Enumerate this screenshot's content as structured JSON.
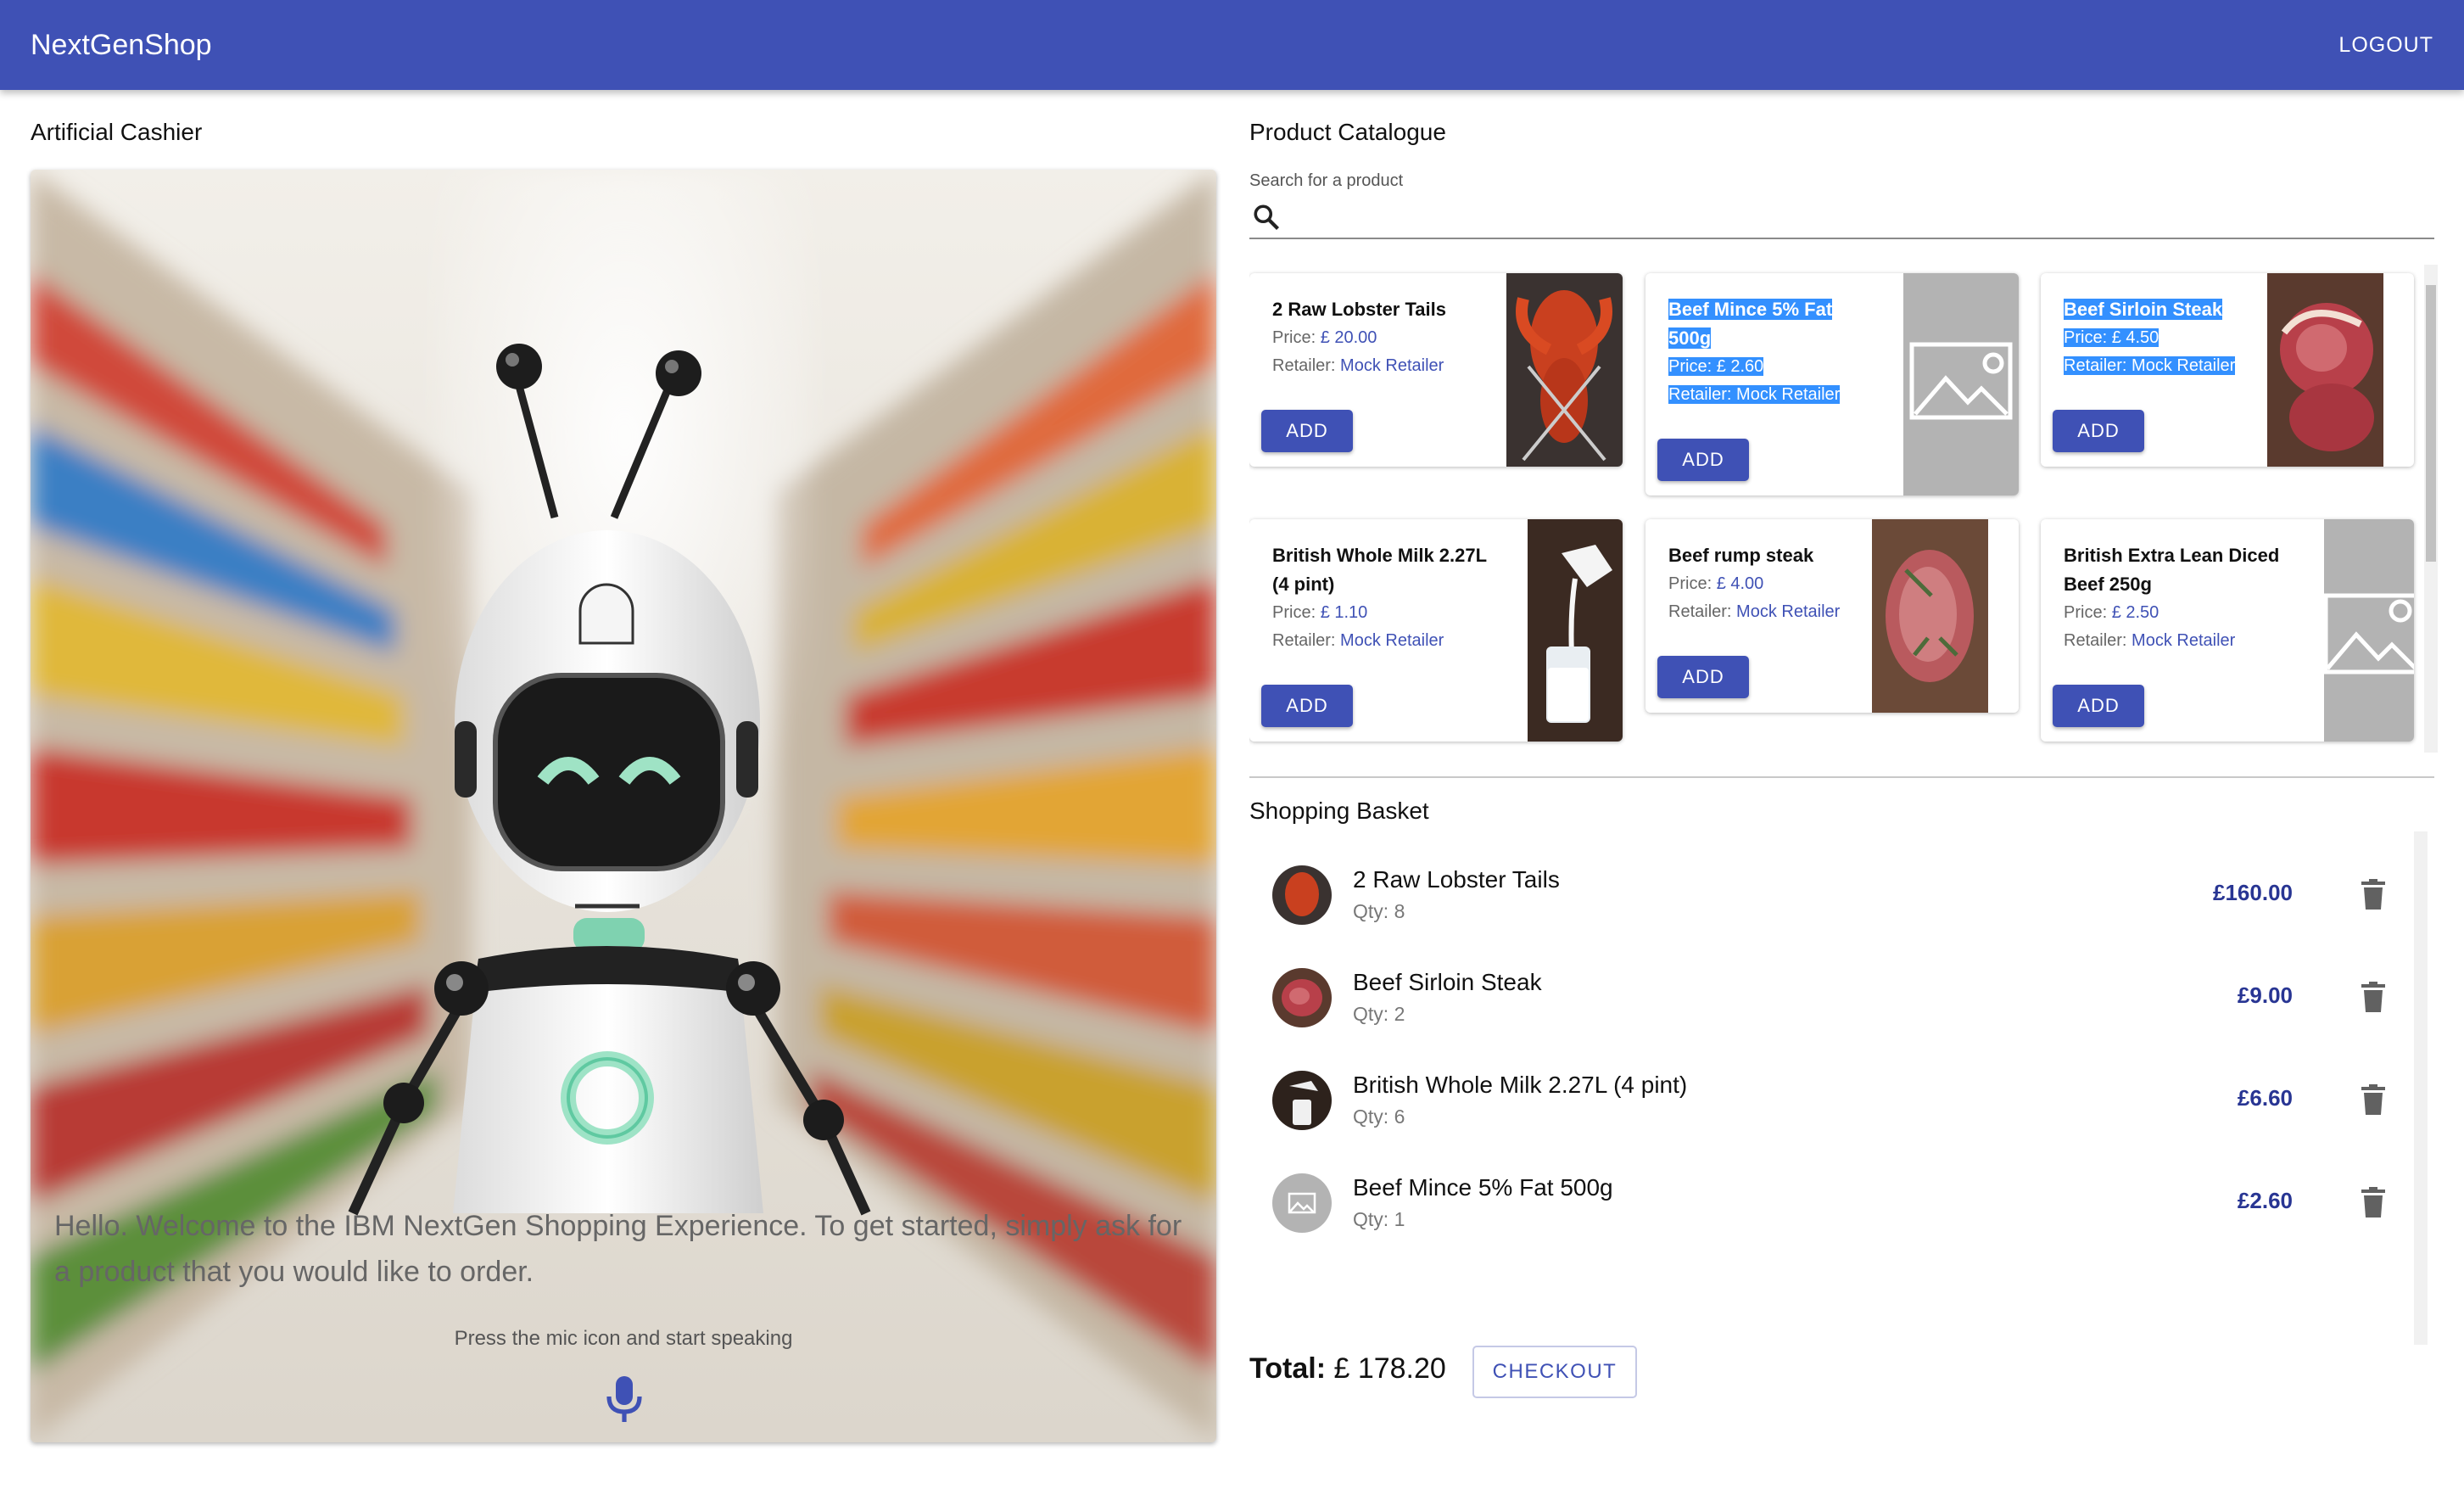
{
  "app": {
    "brand": "NextGenShop",
    "logout_label": "LOGOUT",
    "accent": "#3f51b5"
  },
  "cashier": {
    "title": "Artificial Cashier",
    "welcome": "Hello. Welcome to the IBM NextGen Shopping Experience. To get started, simply ask for a product that you would like to order.",
    "hint": "Press the mic icon and start speaking",
    "mic_icon": "mic-icon"
  },
  "catalogue": {
    "title": "Product Catalogue",
    "search_label": "Search for a product",
    "search_value": "",
    "price_prefix": "Price:",
    "retailer_prefix": "Retailer:",
    "add_label": "ADD",
    "products": [
      {
        "name_lines": [
          "2 Raw Lobster Tails"
        ],
        "price": "£ 20.00",
        "retailer": "Mock Retailer",
        "image": "lobster-image",
        "selected": false
      },
      {
        "name_lines": [
          "Beef Mince 5% Fat",
          "500g"
        ],
        "price": "£ 2.60",
        "retailer": "Mock Retailer",
        "image": "placeholder-image",
        "selected": true
      },
      {
        "name_lines": [
          "Beef Sirloin Steak"
        ],
        "price": "£ 4.50",
        "retailer": "Mock Retailer",
        "image": "sirloin-image",
        "selected": true
      },
      {
        "name_lines": [
          "British Whole Milk 2.27L",
          "(4 pint)"
        ],
        "price": "£ 1.10",
        "retailer": "Mock Retailer",
        "image": "milk-image",
        "selected": false
      },
      {
        "name_lines": [
          "Beef rump steak"
        ],
        "price": "£ 4.00",
        "retailer": "Mock Retailer",
        "image": "rump-image",
        "selected": false
      },
      {
        "name_lines": [
          "British Extra Lean Diced",
          "Beef 250g"
        ],
        "price": "£ 2.50",
        "retailer": "Mock Retailer",
        "image": "placeholder-image",
        "selected": false
      }
    ]
  },
  "basket": {
    "title": "Shopping Basket",
    "qty_prefix": "Qty:",
    "items": [
      {
        "name": "2 Raw Lobster Tails",
        "qty": "8",
        "total": "£160.00",
        "image": "lobster-image"
      },
      {
        "name": "Beef Sirloin Steak",
        "qty": "2",
        "total": "£9.00",
        "image": "sirloin-image"
      },
      {
        "name": "British Whole Milk 2.27L (4 pint)",
        "qty": "6",
        "total": "£6.60",
        "image": "milk-image"
      },
      {
        "name": "Beef Mince 5% Fat 500g",
        "qty": "1",
        "total": "£2.60",
        "image": "placeholder-image"
      }
    ],
    "total_label": "Total:",
    "total_value": "£ 178.20",
    "checkout_label": "CHECKOUT"
  }
}
